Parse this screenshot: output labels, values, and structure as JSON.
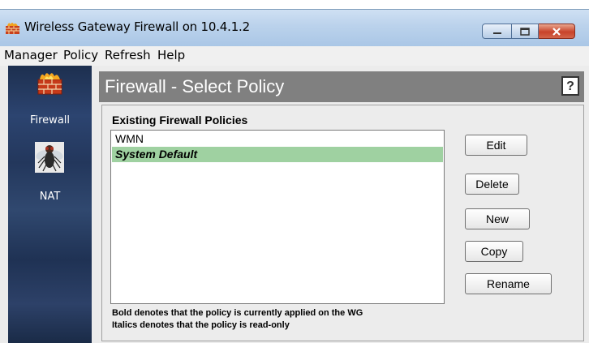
{
  "window": {
    "title": "Wireless Gateway Firewall on 10.4.1.2",
    "controls": [
      "minimize",
      "maximize",
      "close"
    ]
  },
  "menu": {
    "items": [
      "Manager",
      "Policy",
      "Refresh",
      "Help"
    ]
  },
  "sidebar": {
    "items": [
      {
        "label": "Firewall",
        "icon": "firewall-icon"
      },
      {
        "label": "NAT",
        "icon": "fly-icon"
      }
    ]
  },
  "header": {
    "title": "Firewall - Select Policy",
    "help_label": "?"
  },
  "policies": {
    "section_title": "Existing Firewall Policies",
    "items": [
      {
        "label": "WMN",
        "selected": false
      },
      {
        "label": "System Default",
        "selected": true
      }
    ]
  },
  "actions": {
    "edit": "Edit",
    "delete": "Delete",
    "new": "New",
    "copy": "Copy",
    "rename": "Rename"
  },
  "footnotes": {
    "bold_note": "Bold denotes that the policy is currently applied on the WG",
    "italic_note": "Italics denotes that the policy is read-only"
  },
  "colors": {
    "selected_row": "#9fd1a1",
    "header_bar": "#808080",
    "nav_background": "#23375c"
  }
}
